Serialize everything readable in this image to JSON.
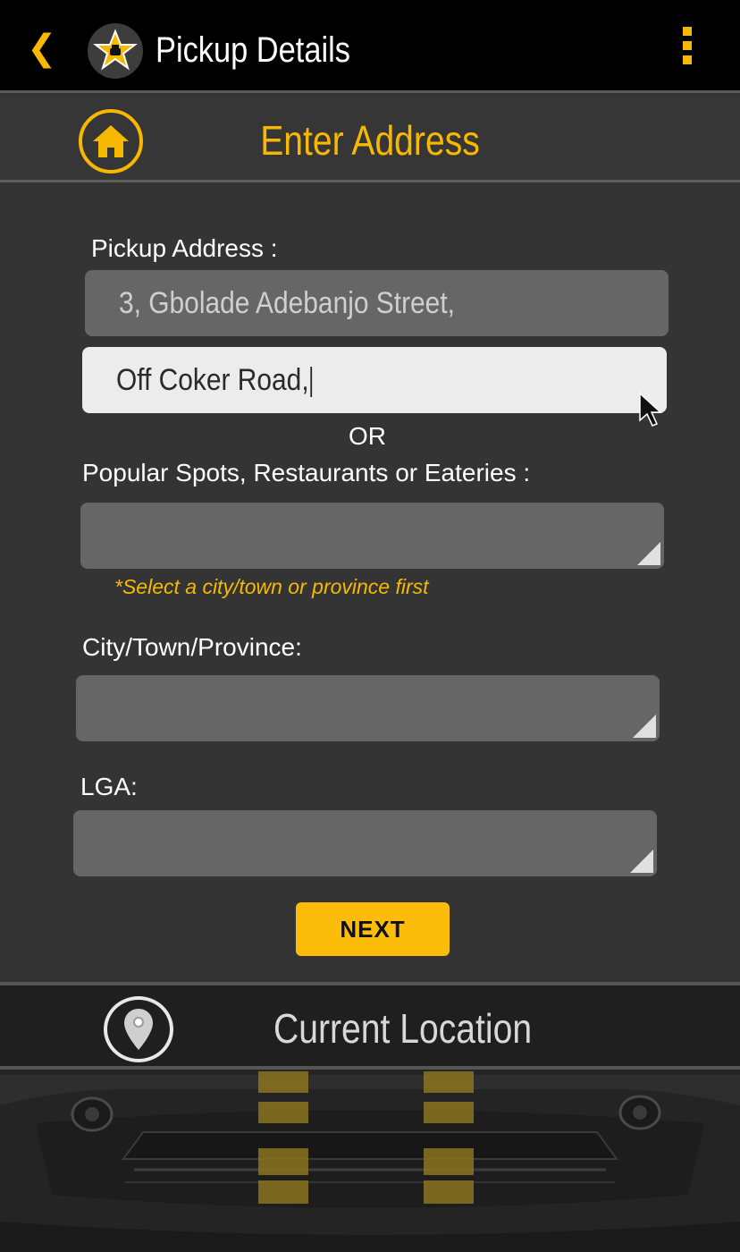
{
  "topbar": {
    "back_glyph": "❮",
    "title": "Pickup Details",
    "accent": "#f7b800"
  },
  "header": {
    "title": "Enter Address",
    "home_icon": "home-icon"
  },
  "form": {
    "pickup_label": "Pickup Address :",
    "address_line1": "3, Gbolade Adebanjo Street,",
    "address_line2": "Off Coker Road,",
    "or_text": "OR",
    "spots_label": "Popular Spots, Restaurants or Eateries :",
    "spots_hint": "*Select a city/town or province first",
    "city_label": "City/Town/Province:",
    "lga_label": "LGA:",
    "next_label": "NEXT"
  },
  "location": {
    "label": "Current Location",
    "icon": "map-pin-icon"
  },
  "colors": {
    "background": "#343434",
    "field": "#666666",
    "active_field": "#ececec",
    "button": "#fbbd09"
  }
}
